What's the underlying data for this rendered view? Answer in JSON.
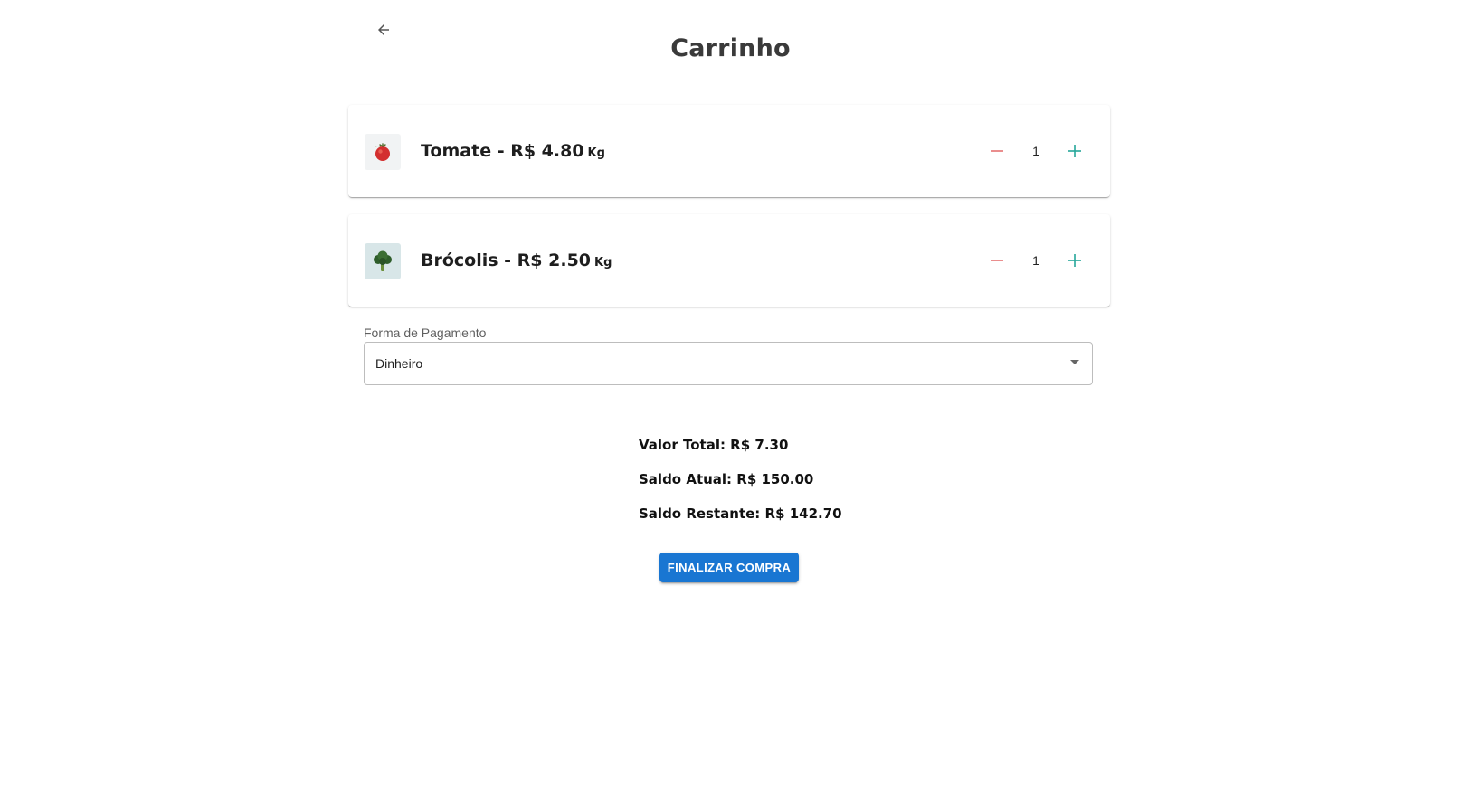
{
  "header": {
    "title": "Carrinho",
    "back_icon": "arrow-left-icon"
  },
  "cart": {
    "items": [
      {
        "name": "Tomate - R$ 4.80",
        "unit": "Kg",
        "quantity": "1",
        "image_icon": "tomato-icon",
        "decrement_icon": "minus-icon",
        "increment_icon": "plus-icon"
      },
      {
        "name": "Brócolis - R$ 2.50",
        "unit": "Kg",
        "quantity": "1",
        "image_icon": "broccoli-icon",
        "decrement_icon": "minus-icon",
        "increment_icon": "plus-icon"
      }
    ]
  },
  "payment": {
    "label": "Forma de Pagamento",
    "selected": "Dinheiro"
  },
  "summary": {
    "total": "Valor Total: R$ 7.30",
    "balance": "Saldo Atual: R$ 150.00",
    "remaining": "Saldo Restante: R$ 142.70"
  },
  "actions": {
    "finish_label": "FINALIZAR COMPRA"
  },
  "colors": {
    "primary": "#1976d2",
    "decrement": "#e57373",
    "increment": "#26a69a"
  }
}
